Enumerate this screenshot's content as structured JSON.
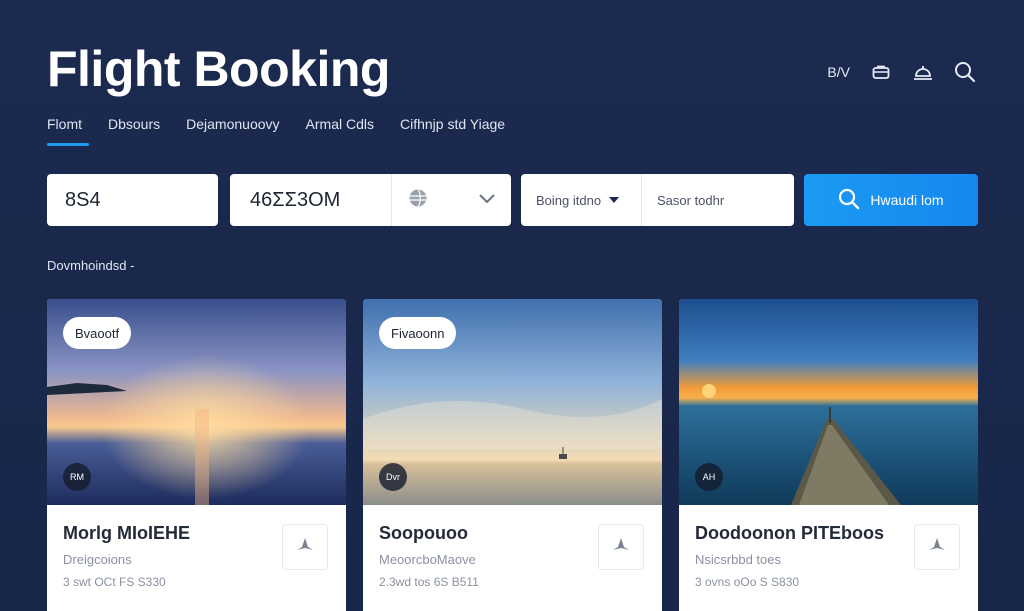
{
  "header": {
    "title": "Flight Booking",
    "icons": [
      {
        "name": "currency-icon",
        "label": "B/V"
      },
      {
        "name": "bag-icon",
        "label": ""
      },
      {
        "name": "hotel-bell-icon",
        "label": ""
      },
      {
        "name": "search-icon",
        "label": ""
      }
    ]
  },
  "tabs": [
    {
      "label": "Flomt",
      "active": true
    },
    {
      "label": "Dbsours",
      "active": false
    },
    {
      "label": "Dejamonuoovy",
      "active": false
    },
    {
      "label": "Armal Cdls",
      "active": false
    },
    {
      "label": "Cifhnjp std Yiage",
      "active": false
    }
  ],
  "search": {
    "from_value": "8S4",
    "date_value": "46ΣΣ3OM",
    "travel_label": "Boing itdno",
    "class_value": "Sasor todhr",
    "button_label": "Hwaudi lom"
  },
  "section_label": "Dovmhoindsd -",
  "cards": [
    {
      "tag": "Bvaootf",
      "badge": "RM",
      "title": "Morlg MIoIEHE",
      "subtitle": "Dreigcoions",
      "price": "3 swt OCt FS S330"
    },
    {
      "tag": "Fivaoonn",
      "badge": "Dvr",
      "title": "Soopouoo",
      "subtitle": "MeoorcboMaove",
      "price": "2.3wd tos 6S B511"
    },
    {
      "tag": "",
      "badge": "AH",
      "title": "Doodoonon PITEboos",
      "subtitle": "Nsicsrbbd toes",
      "price": "3 ovns oOo S S830"
    }
  ],
  "colors": {
    "background": "#1b2a4e",
    "accent": "#1f9bf0",
    "card": "#ffffff"
  }
}
